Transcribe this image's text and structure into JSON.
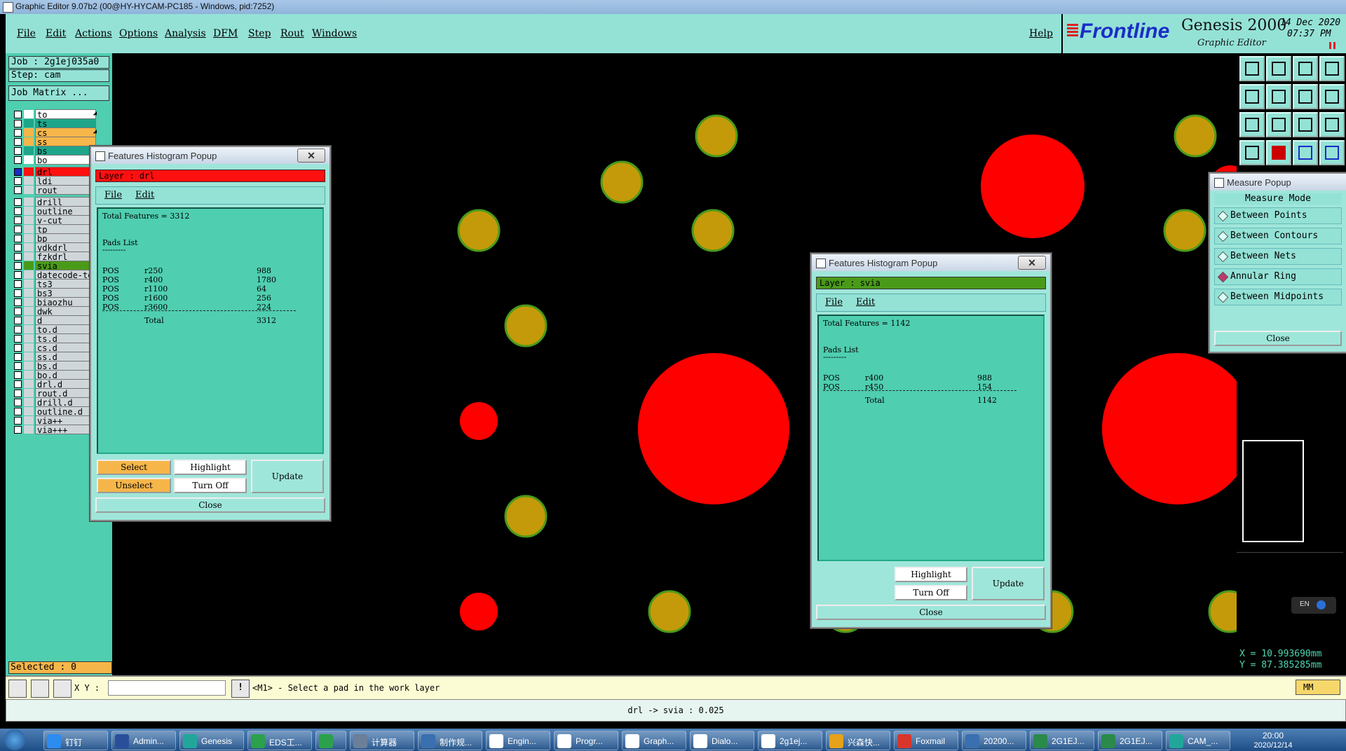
{
  "window": {
    "title": "Graphic Editor 9.07b2 (00@HY-HYCAM-PC185 - Windows, pid:7252)"
  },
  "menu": [
    "File",
    "Edit",
    "Actions",
    "Options",
    "Analysis",
    "DFM",
    "Step",
    "Rout",
    "Windows"
  ],
  "help": "Help",
  "brand": {
    "logo": "Frontline",
    "product": "Genesis 2000",
    "subtitle": "Graphic Editor",
    "date": "14 Dec 2020",
    "time": "07:37 PM"
  },
  "job": {
    "job": "Job : 2g1ej035a0",
    "step": "Step: cam",
    "matrix": "Job Matrix ..."
  },
  "layers": [
    {
      "name": "to",
      "color": "#ffffff",
      "arrow": "◢"
    },
    {
      "name": "ts",
      "color": "#1fa58a",
      "arrow": ""
    },
    {
      "name": "cs",
      "color": "#f6b64a",
      "arrow": "◢"
    },
    {
      "name": "ss",
      "color": "#f6b64a",
      "arrow": ""
    },
    {
      "name": "bs",
      "color": "#1fa58a",
      "arrow": ""
    },
    {
      "name": "bo",
      "color": "#ffffff",
      "arrow": ""
    },
    {
      "name": "drl",
      "color": "#ff1010",
      "arrow": "",
      "selected": true
    },
    {
      "name": "ldi",
      "color": "#cfd6da",
      "arrow": ""
    },
    {
      "name": "rout",
      "color": "#cfd6da",
      "arrow": ""
    },
    {
      "name": "drill",
      "color": "#cfd6da",
      "arrow": "◢"
    },
    {
      "name": "outline",
      "color": "#cfd6da",
      "arrow": "◢"
    },
    {
      "name": "v-cut",
      "color": "#cfd6da",
      "arrow": ""
    },
    {
      "name": "tp",
      "color": "#cfd6da",
      "arrow": ""
    },
    {
      "name": "bp",
      "color": "#cfd6da",
      "arrow": ""
    },
    {
      "name": "ydkdrl",
      "color": "#cfd6da",
      "arrow": "◢"
    },
    {
      "name": "fzkdrl",
      "color": "#cfd6da",
      "arrow": "◢"
    },
    {
      "name": "svia",
      "color": "#4a9a1a",
      "arrow": ""
    },
    {
      "name": "datecode-to",
      "color": "#cfd6da",
      "arrow": ""
    },
    {
      "name": "ts3",
      "color": "#cfd6da",
      "arrow": ""
    },
    {
      "name": "bs3",
      "color": "#cfd6da",
      "arrow": ""
    },
    {
      "name": "biaozhu",
      "color": "#cfd6da",
      "arrow": ""
    },
    {
      "name": "dwk",
      "color": "#cfd6da",
      "arrow": ""
    },
    {
      "name": "d",
      "color": "#cfd6da",
      "arrow": ""
    },
    {
      "name": "to.d",
      "color": "#cfd6da",
      "arrow": "◢"
    },
    {
      "name": "ts.d",
      "color": "#cfd6da",
      "arrow": ""
    },
    {
      "name": "cs.d",
      "color": "#cfd6da",
      "arrow": "◢"
    },
    {
      "name": "ss.d",
      "color": "#cfd6da",
      "arrow": ""
    },
    {
      "name": "bs.d",
      "color": "#cfd6da",
      "arrow": ""
    },
    {
      "name": "bo.d",
      "color": "#cfd6da",
      "arrow": ""
    },
    {
      "name": "drl.d",
      "color": "#cfd6da",
      "arrow": ""
    },
    {
      "name": "rout.d",
      "color": "#cfd6da",
      "arrow": ""
    },
    {
      "name": "drill.d",
      "color": "#cfd6da",
      "arrow": "◢"
    },
    {
      "name": "outline.d",
      "color": "#cfd6da",
      "arrow": "◢"
    },
    {
      "name": "via++",
      "color": "#cfd6da",
      "arrow": ""
    },
    {
      "name": "via+++",
      "color": "#cfd6da",
      "arrow": ""
    }
  ],
  "selected": "Selected : 0",
  "popup1": {
    "title": "Features Histogram Popup",
    "layer": "Layer :  drl",
    "layer_color": "#ff1010",
    "menu": [
      "File",
      "Edit"
    ],
    "total": "Total Features = 3312",
    "list_title": "Pads List",
    "rows": [
      [
        "POS",
        "r250",
        "988"
      ],
      [
        "POS",
        "r400",
        "1780"
      ],
      [
        "POS",
        "r1100",
        "64"
      ],
      [
        "POS",
        "r1600",
        "256"
      ],
      [
        "POS",
        "r3600",
        "224"
      ]
    ],
    "total_label": "Total",
    "total_value": "3312",
    "buttons": {
      "select": "Select",
      "unselect": "Unselect",
      "highlight": "Highlight",
      "turnoff": "Turn Off",
      "update": "Update",
      "close": "Close"
    }
  },
  "popup2": {
    "title": "Features Histogram Popup",
    "layer": "Layer :  svia",
    "layer_color": "#4a9a1a",
    "menu": [
      "File",
      "Edit"
    ],
    "total": "Total Features = 1142",
    "list_title": "Pads List",
    "rows": [
      [
        "POS",
        "r400",
        "988"
      ],
      [
        "POS",
        "r450",
        "154"
      ]
    ],
    "total_label": "Total",
    "total_value": "1142",
    "buttons": {
      "highlight": "Highlight",
      "turnoff": "Turn Off",
      "update": "Update",
      "close": "Close"
    }
  },
  "measure": {
    "title": "Measure Popup",
    "mode": "Measure Mode",
    "options": [
      "Between Points",
      "Between Contours",
      "Between Nets",
      "Annular Ring",
      "Between Midpoints"
    ],
    "active": 3,
    "close": "Close"
  },
  "coords": {
    "x": "X = 10.993690mm",
    "y": "Y = 87.385285mm"
  },
  "lang": "EN",
  "cmd": {
    "xy_label": "X Y :",
    "xy_value": "",
    "prompt": "<M1> - Select a pad in the work layer",
    "unit": "MM"
  },
  "status": "drl -> svia : 0.025",
  "taskbar": [
    {
      "label": "钉钉",
      "color": "#2d8cf0"
    },
    {
      "label": "Admin...",
      "color": "#2a4f9a"
    },
    {
      "label": "Genesis",
      "color": "#23a69a"
    },
    {
      "label": "EDS工...",
      "color": "#2aa14a"
    },
    {
      "label": "",
      "color": "#2aa14a"
    },
    {
      "label": "计算器",
      "color": "#6b7f99"
    },
    {
      "label": "制作规...",
      "color": "#3a6fb0"
    },
    {
      "label": "Engin...",
      "color": "#ffffff"
    },
    {
      "label": "Progr...",
      "color": "#ffffff"
    },
    {
      "label": "Graph...",
      "color": "#ffffff"
    },
    {
      "label": "Dialo...",
      "color": "#ffffff"
    },
    {
      "label": "2g1ej...",
      "color": "#ffffff"
    },
    {
      "label": "兴森快...",
      "color": "#e6a21a"
    },
    {
      "label": "Foxmail",
      "color": "#d9362b"
    },
    {
      "label": "20200...",
      "color": "#3a6fb0"
    },
    {
      "label": "2G1EJ...",
      "color": "#2a8a4a"
    },
    {
      "label": "2G1EJ...",
      "color": "#2a8a4a"
    },
    {
      "label": "CAM_...",
      "color": "#23a69a"
    }
  ],
  "clock": {
    "time": "20:00",
    "date": "2020/12/14"
  }
}
